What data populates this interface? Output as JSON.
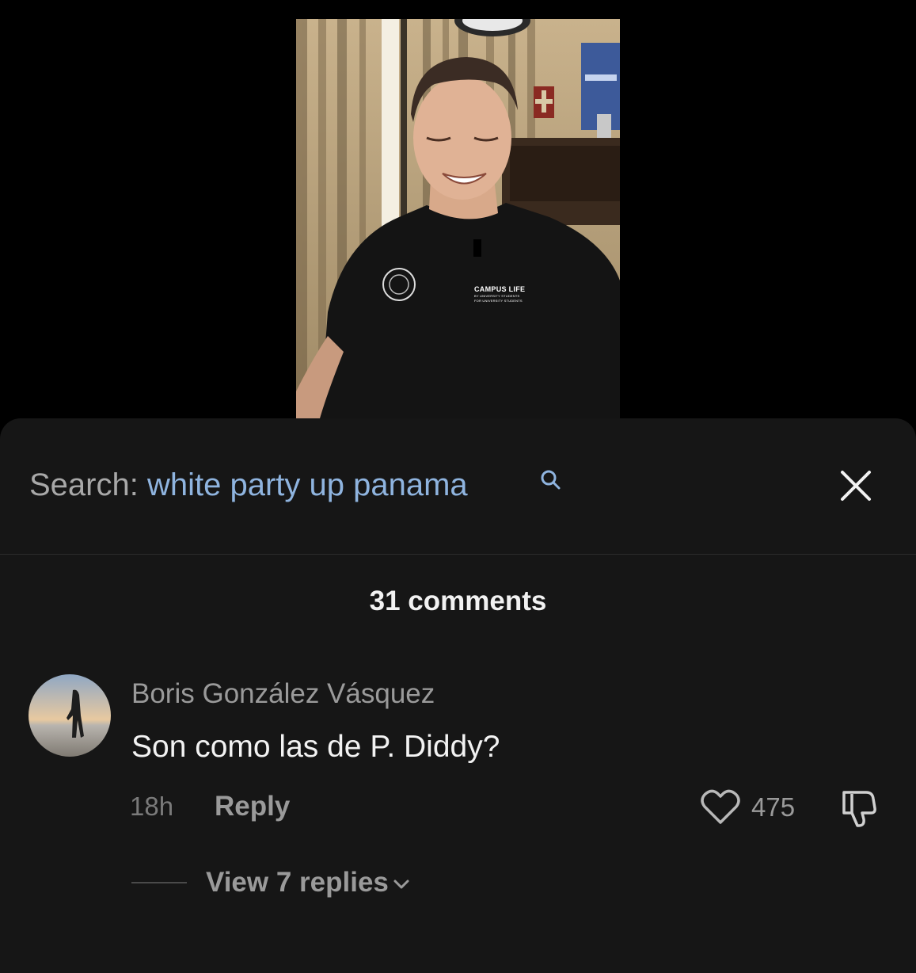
{
  "video": {
    "shirt_title": "CAMPUS LIFE",
    "shirt_subtitle_1": "BY UNIVERSITY STUDENTS",
    "shirt_subtitle_2": "FOR UNIVERSITY STUDENTS"
  },
  "search": {
    "label": "Search: ",
    "term": "white party up panama"
  },
  "comments_header": {
    "count_label": "31 comments"
  },
  "comment": {
    "author": "Boris González Vásquez",
    "text": "Son como las de P. Diddy?",
    "time": "18h",
    "reply_label": "Reply",
    "likes": "475",
    "view_replies_label": "View 7 replies"
  },
  "colors": {
    "background": "#000000",
    "sheet": "#161616",
    "search_term": "#8fb4df",
    "muted_text": "#9a9a9a"
  }
}
